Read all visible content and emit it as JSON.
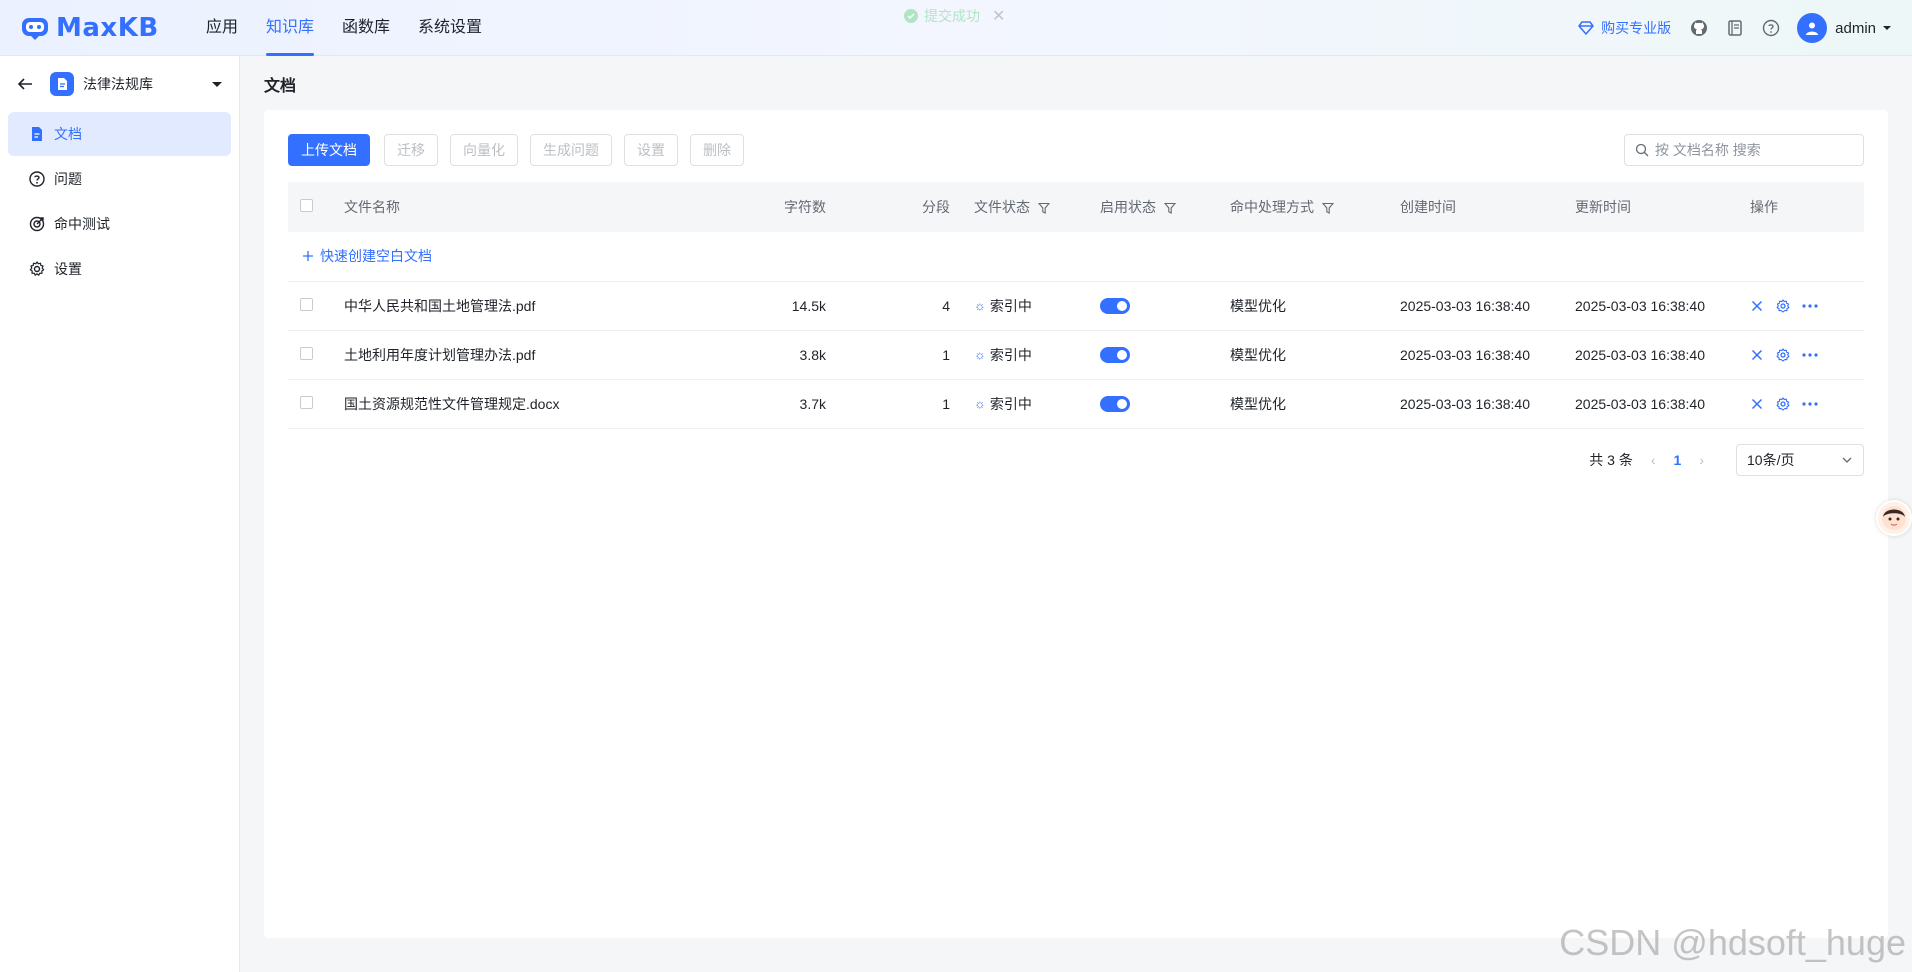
{
  "brand": {
    "name": "MaxKB"
  },
  "nav": [
    {
      "label": "应用",
      "active": false
    },
    {
      "label": "知识库",
      "active": true
    },
    {
      "label": "函数库",
      "active": false
    },
    {
      "label": "系统设置",
      "active": false
    }
  ],
  "toast": {
    "message": "提交成功"
  },
  "header": {
    "upgrade_label": "购买专业版",
    "user": "admin"
  },
  "sidebar": {
    "kb_name": "法律法规库",
    "items": [
      {
        "label": "文档",
        "active": true,
        "icon": "document-icon"
      },
      {
        "label": "问题",
        "active": false,
        "icon": "question-icon"
      },
      {
        "label": "命中测试",
        "active": false,
        "icon": "target-icon"
      },
      {
        "label": "设置",
        "active": false,
        "icon": "gear-icon"
      }
    ]
  },
  "page": {
    "title": "文档"
  },
  "toolbar": {
    "upload": "上传文档",
    "migrate": "迁移",
    "vectorize": "向量化",
    "generate": "生成问题",
    "settings": "设置",
    "delete": "删除"
  },
  "search": {
    "placeholder": "按 文档名称 搜索"
  },
  "table": {
    "headers": {
      "name": "文件名称",
      "chars": "字符数",
      "segments": "分段",
      "file_status": "文件状态",
      "enable_status": "启用状态",
      "hit_mode": "命中处理方式",
      "created": "创建时间",
      "updated": "更新时间",
      "actions": "操作"
    },
    "quick_create": "快速创建空白文档",
    "rows": [
      {
        "name": "中华人民共和国土地管理法.pdf",
        "chars": "14.5k",
        "segments": "4",
        "status": "索引中",
        "enabled": true,
        "hit_mode": "模型优化",
        "created": "2025-03-03 16:38:40",
        "updated": "2025-03-03 16:38:40"
      },
      {
        "name": "土地利用年度计划管理办法.pdf",
        "chars": "3.8k",
        "segments": "1",
        "status": "索引中",
        "enabled": true,
        "hit_mode": "模型优化",
        "created": "2025-03-03 16:38:40",
        "updated": "2025-03-03 16:38:40"
      },
      {
        "name": "国土资源规范性文件管理规定.docx",
        "chars": "3.7k",
        "segments": "1",
        "status": "索引中",
        "enabled": true,
        "hit_mode": "模型优化",
        "created": "2025-03-03 16:38:40",
        "updated": "2025-03-03 16:38:40"
      }
    ]
  },
  "pagination": {
    "total": "共 3 条",
    "current": "1",
    "page_size": "10条/页"
  },
  "watermark": "CSDN @hdsoft_huge"
}
